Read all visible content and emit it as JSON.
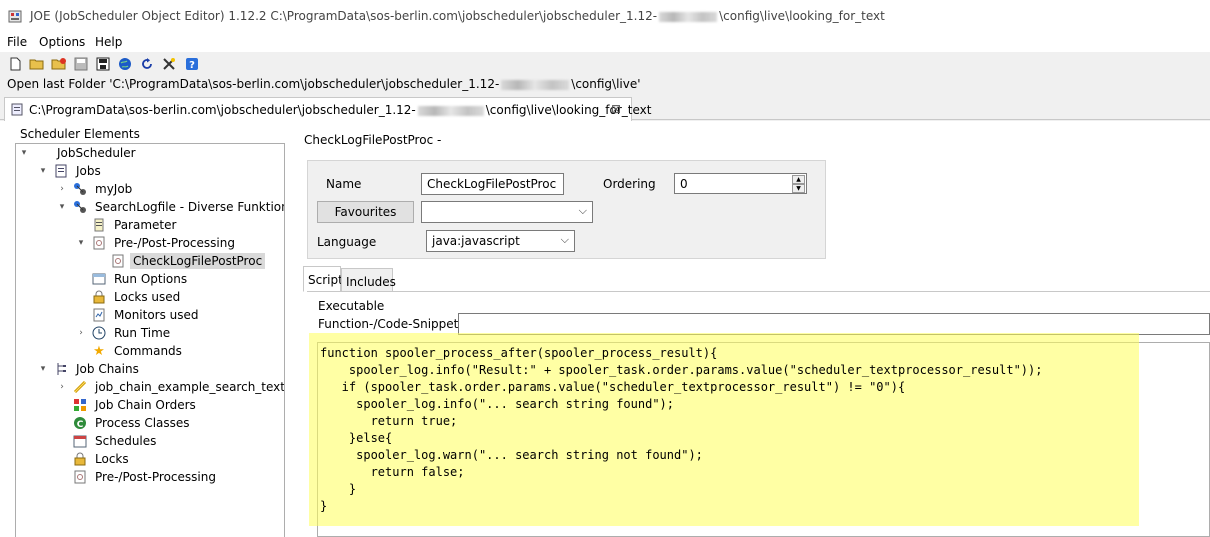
{
  "window": {
    "title_prefix": "JOE (JobScheduler Object Editor) 1.12.2 C:\\ProgramData\\sos-berlin.com\\jobscheduler\\jobscheduler_1.12-",
    "title_suffix": "\\config\\live\\looking_for_text"
  },
  "menu": {
    "file": "File",
    "options": "Options",
    "help": "Help"
  },
  "toolbar": {
    "icons": [
      "new-file-icon",
      "open-folder-icon",
      "open-remote-icon",
      "save-icon",
      "save-as-icon",
      "globe-icon",
      "reload-icon",
      "tools-icon",
      "help-icon"
    ]
  },
  "last_folder": {
    "prefix": "Open last Folder 'C:\\ProgramData\\sos-berlin.com\\jobscheduler\\jobscheduler_1.12-",
    "suffix": "\\config\\live'"
  },
  "editor_tab": {
    "prefix": "C:\\ProgramData\\sos-berlin.com\\jobscheduler\\jobscheduler_1.12-",
    "suffix": "\\config\\live\\looking_for_text",
    "close": "⊠"
  },
  "tree": {
    "title": "Scheduler Elements",
    "nodes": [
      {
        "label": "JobScheduler"
      },
      {
        "label": "Jobs"
      },
      {
        "label": "myJob"
      },
      {
        "label": "SearchLogfile - Diverse Funktionen"
      },
      {
        "label": "Parameter"
      },
      {
        "label": "Pre-/Post-Processing"
      },
      {
        "label": "CheckLogFilePostProc"
      },
      {
        "label": "Run Options"
      },
      {
        "label": "Locks used"
      },
      {
        "label": "Monitors used"
      },
      {
        "label": "Run Time"
      },
      {
        "label": "Commands"
      },
      {
        "label": "Job Chains"
      },
      {
        "label": "job_chain_example_search_text"
      },
      {
        "label": "Job Chain Orders"
      },
      {
        "label": "Process Classes"
      },
      {
        "label": "Schedules"
      },
      {
        "label": "Locks"
      },
      {
        "label": "Pre-/Post-Processing"
      }
    ]
  },
  "form": {
    "panel_title": "CheckLogFilePostProc -",
    "name_label": "Name",
    "name_value": "CheckLogFilePostProc",
    "ordering_label": "Ordering",
    "ordering_value": "0",
    "favourites_button": "Favourites",
    "favourites_value": "",
    "language_label": "Language",
    "language_value": "java:javascript"
  },
  "script_tabs": {
    "script": "Script",
    "includes": "Includes"
  },
  "script_panel": {
    "executable_label": "Executable",
    "snippets_label": "Function-/Code-Snippets",
    "snippets_value": "",
    "code": "function spooler_process_after(spooler_process_result){\n    spooler_log.info(\"Result:\" + spooler_task.order.params.value(\"scheduler_textprocessor_result\"));\n   if (spooler_task.order.params.value(\"scheduler_textprocessor_result\") != \"0\"){\n     spooler_log.info(\"... search string found\");\n       return true;\n    }else{\n     spooler_log.warn(\"... search string not found\");\n       return false;\n    }\n}",
    "highlight_color": "#ffff5a"
  }
}
